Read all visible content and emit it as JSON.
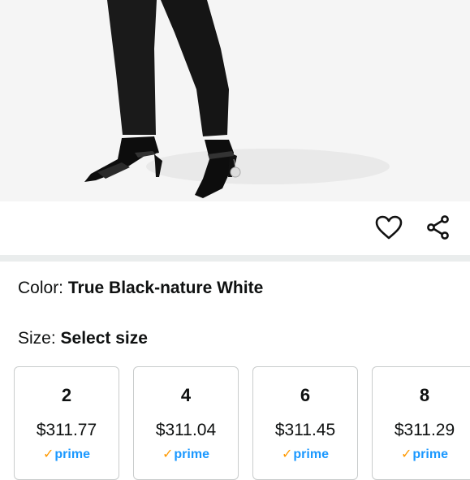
{
  "product_image": {
    "description_icon": "product-photo"
  },
  "actions": {
    "heart_icon": "heart-icon",
    "share_icon": "share-icon"
  },
  "color": {
    "label": "Color: ",
    "value": "True Black-nature White"
  },
  "size": {
    "label": "Size: ",
    "value": "Select size"
  },
  "sizes": [
    {
      "size": "2",
      "price": "$311.77",
      "prime": "prime"
    },
    {
      "size": "4",
      "price": "$311.04",
      "prime": "prime"
    },
    {
      "size": "6",
      "price": "$311.45",
      "prime": "prime"
    },
    {
      "size": "8",
      "price": "$311.29",
      "prime": "prime"
    }
  ],
  "colors": {
    "prime_blue": "#1a98ff",
    "prime_check": "#ff9900",
    "divider": "#eaeded"
  }
}
